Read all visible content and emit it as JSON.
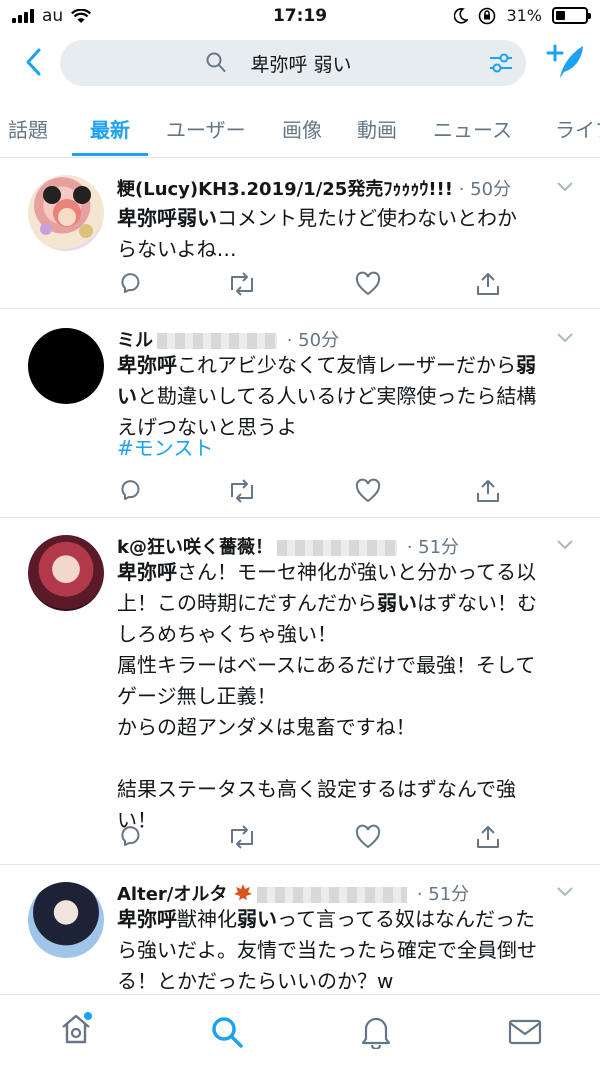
{
  "status_bar": {
    "carrier": "au",
    "time": "17:19",
    "battery": "31%",
    "battery_level": 0.31
  },
  "search": {
    "query": "卑弥呼 弱い"
  },
  "tabs": [
    {
      "label": "話題",
      "active": false
    },
    {
      "label": "最新",
      "active": true
    },
    {
      "label": "ユーザー",
      "active": false
    },
    {
      "label": "画像",
      "active": false
    },
    {
      "label": "動画",
      "active": false
    },
    {
      "label": "ニュース",
      "active": false
    },
    {
      "label": "ライブ",
      "active": false
    }
  ],
  "tweets": [
    {
      "name": "粳(Lucy)KH3.2019/1/25発売ﾌｩｩｩｳ!!!",
      "time": "50分",
      "lines": [
        [
          {
            "b": "卑弥呼弱い"
          },
          {
            "t": "コメント見たけど使わないとわか"
          }
        ],
        [
          {
            "t": "らないよね…"
          }
        ]
      ]
    },
    {
      "name": "ミル",
      "time": "50分",
      "lines": [
        [
          {
            "b": "卑弥呼"
          },
          {
            "t": "これアビ少なくて友情レーザーだから"
          },
          {
            "b": "弱"
          }
        ],
        [
          {
            "b": "い"
          },
          {
            "t": "と勘違いしてる人いるけど実際使ったら結構"
          }
        ],
        [
          {
            "t": "えげつないと思うよ"
          }
        ]
      ],
      "hashtag": "#モンスト"
    },
    {
      "name": "k@狂い咲く薔薇！",
      "time": "51分",
      "lines": [
        [
          {
            "b": "卑弥呼"
          },
          {
            "t": "さん！モーセ神化が強いと分かってる以"
          }
        ],
        [
          {
            "t": "上！この時期にだすんだから"
          },
          {
            "b": "弱い"
          },
          {
            "t": "はずない！む"
          }
        ],
        [
          {
            "t": "しろめちゃくちゃ強い！"
          }
        ],
        [
          {
            "t": "属性キラーはベースにあるだけで最強！そして"
          }
        ],
        [
          {
            "t": "ゲージ無し正義！"
          }
        ],
        [
          {
            "t": "からの超アンダメは鬼畜ですね！"
          }
        ],
        [
          {
            "t": ""
          }
        ],
        [
          {
            "t": "結果ステータスも高く設定するはずなんで強"
          }
        ],
        [
          {
            "t": "い！"
          }
        ]
      ]
    },
    {
      "name": "Alter/オルタ",
      "time": "51分",
      "lines": [
        [
          {
            "b": "卑弥呼"
          },
          {
            "t": "獣神化"
          },
          {
            "b": "弱い"
          },
          {
            "t": "って言ってる奴はなんだった"
          }
        ],
        [
          {
            "t": "ら強いだよ。友情で当たったら確定で全員倒せ"
          }
        ],
        [
          {
            "t": "る！とかだったらいいのか？w"
          }
        ]
      ]
    }
  ],
  "colors": {
    "accent": "#1da1f2",
    "secondary": "#657786",
    "divider": "#e1e8ed"
  }
}
